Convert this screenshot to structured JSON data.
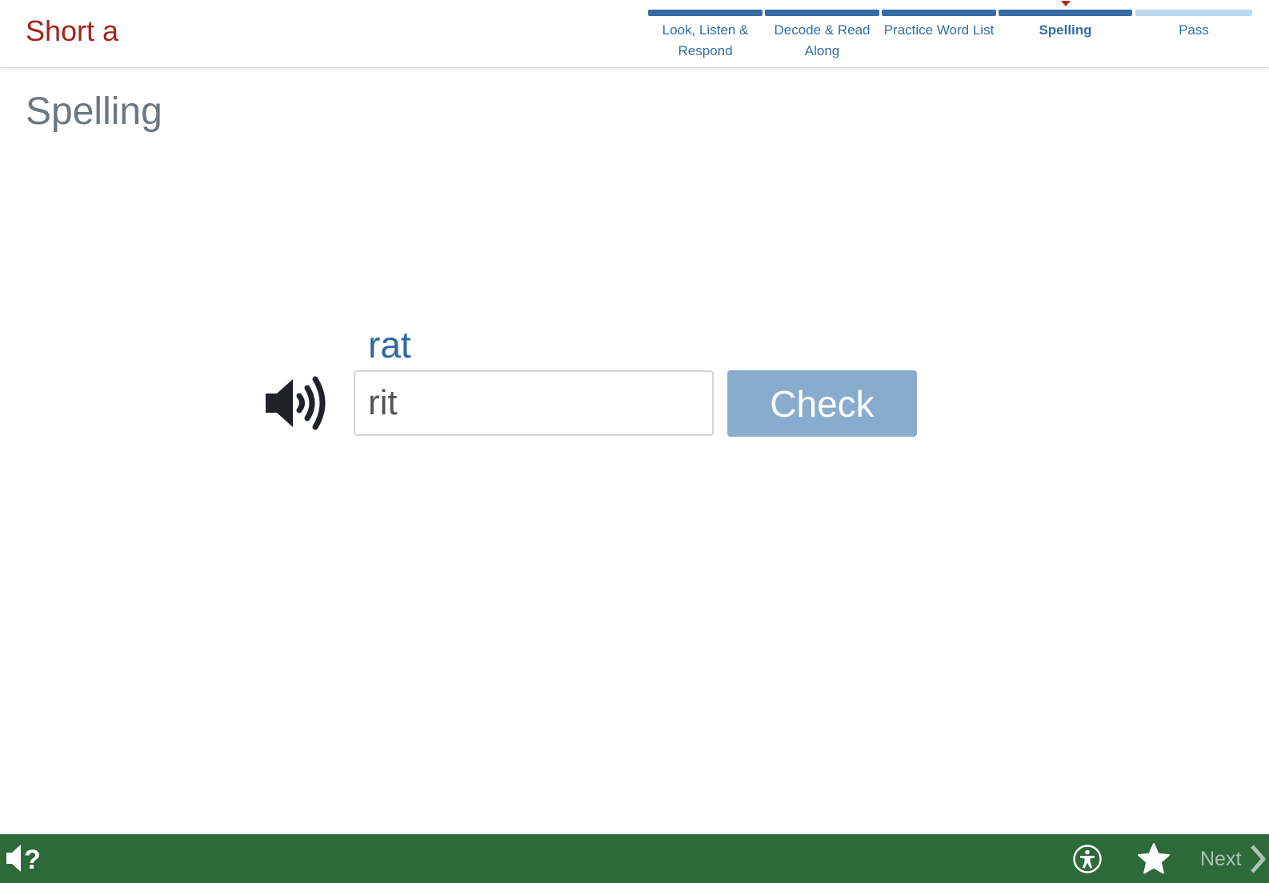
{
  "header": {
    "lesson_title": "Short a",
    "steps": [
      {
        "label": "Look, Listen & Respond",
        "state": "completed"
      },
      {
        "label": "Decode & Read Along",
        "state": "completed"
      },
      {
        "label": "Practice Word List",
        "state": "completed"
      },
      {
        "label": "Spelling",
        "state": "current"
      },
      {
        "label": "Pass",
        "state": "future"
      }
    ]
  },
  "page": {
    "title": "Spelling"
  },
  "exercise": {
    "target_word": "rat",
    "answer_value": "rit",
    "check_label": "Check",
    "speaker_icon": "speaker-icon"
  },
  "footer": {
    "help_icon": "audio-help-icon",
    "accessibility_icon": "accessibility-icon",
    "star_icon": "star-icon",
    "next_label": "Next",
    "next_icon": "chevron-right-icon"
  },
  "colors": {
    "lesson_title": "#a32518",
    "progress_complete": "#336da3",
    "progress_future": "#bcd8ef",
    "current_marker": "#b52a1f",
    "target_word": "#2f69a3",
    "check_button": "#88abce",
    "footer_bg": "#2d6a3a"
  }
}
